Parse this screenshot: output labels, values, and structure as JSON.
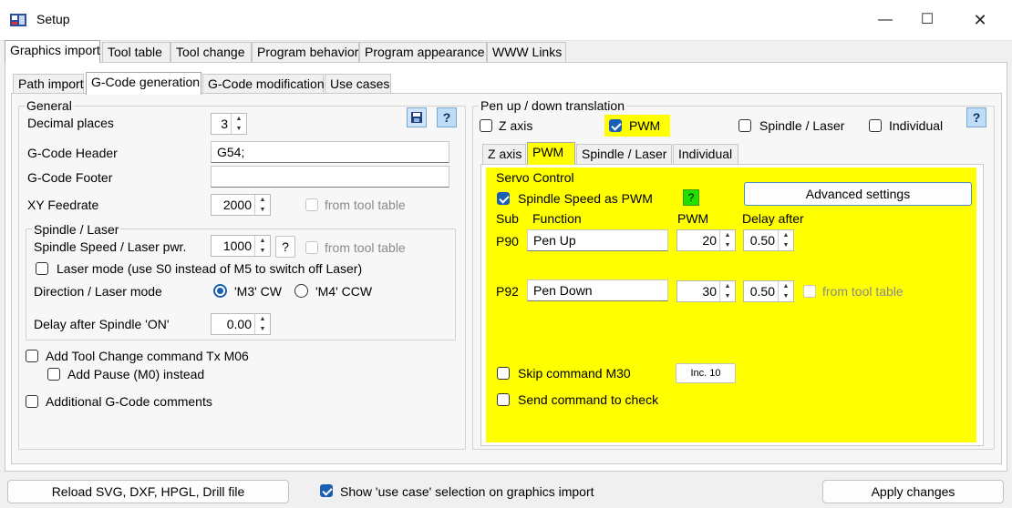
{
  "window": {
    "title": "Setup"
  },
  "main_tabs": [
    "Graphics import",
    "Tool table",
    "Tool change",
    "Program behavior",
    "Program appearance",
    "WWW Links"
  ],
  "sub_tabs": [
    "Path import",
    "G-Code generation",
    "G-Code modification",
    "Use cases"
  ],
  "general": {
    "title": "General",
    "decimal_places_label": "Decimal places",
    "decimal_places_value": "3",
    "header_label": "G-Code Header",
    "header_value": "G54;",
    "footer_label": "G-Code Footer",
    "footer_value": "",
    "feedrate_label": "XY Feedrate",
    "feedrate_value": "2000",
    "from_tool_table": "from tool table",
    "help": "?"
  },
  "spindle": {
    "title": "Spindle / Laser",
    "speed_label": "Spindle Speed / Laser pwr.",
    "speed_value": "1000",
    "help": "?",
    "from_tool_table": "from tool table",
    "laser_mode_label": "Laser mode (use S0 instead of M5 to switch off Laser)",
    "direction_label": "Direction / Laser mode",
    "cw_label": "'M3' CW",
    "ccw_label": "'M4' CCW",
    "delay_label": "Delay after Spindle 'ON'",
    "delay_value": "0.00"
  },
  "options": {
    "tool_change_label": "Add Tool Change command Tx M06",
    "pause_label": "Add Pause (M0) instead",
    "comments_label": "Additional G-Code comments"
  },
  "pen": {
    "title": "Pen up / down translation",
    "z_axis": "Z axis",
    "pwm": "PWM",
    "spindle_laser": "Spindle / Laser",
    "individual": "Individual",
    "help": "?",
    "tabs": [
      "Z axis",
      "PWM",
      "Spindle / Laser",
      "Individual"
    ],
    "servo": {
      "title": "Servo Control",
      "spindle_pwm_label": "Spindle Speed as PWM",
      "help": "?",
      "advanced_button": "Advanced settings",
      "col_sub": "Sub",
      "col_function": "Function",
      "col_pwm": "PWM",
      "col_delay": "Delay after",
      "row1": {
        "sub": "P90",
        "function": "Pen Up",
        "pwm": "20",
        "delay": "0.50"
      },
      "row2": {
        "sub": "P92",
        "function": "Pen Down",
        "pwm": "30",
        "delay": "0.50",
        "from_tool_table": "from tool table"
      },
      "skip_m30_label": "Skip command M30",
      "inc_button": "Inc. 10",
      "send_check_label": "Send command to check"
    }
  },
  "bottom": {
    "reload_button": "Reload SVG, DXF, HPGL, Drill file",
    "show_use_case_label": "Show 'use case' selection on graphics import",
    "apply_button": "Apply changes"
  },
  "colors": {
    "highlight": "#ffff00",
    "green_help": "#22e000",
    "accent": "#1a5fb4"
  }
}
